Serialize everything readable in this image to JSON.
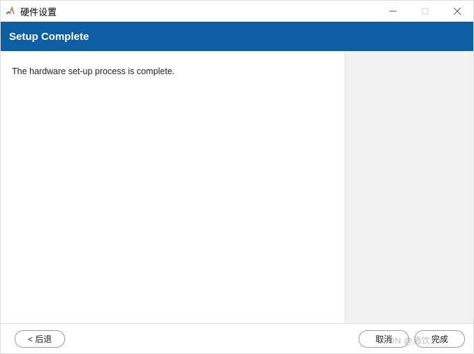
{
  "titlebar": {
    "title": "硬件设置"
  },
  "banner": {
    "heading": "Setup Complete"
  },
  "content": {
    "message": "The hardware set-up process is complete."
  },
  "footer": {
    "back_label": "< 后退",
    "cancel_label": "取消",
    "finish_label": "完成"
  },
  "watermark": "CSDN @酒饮100"
}
